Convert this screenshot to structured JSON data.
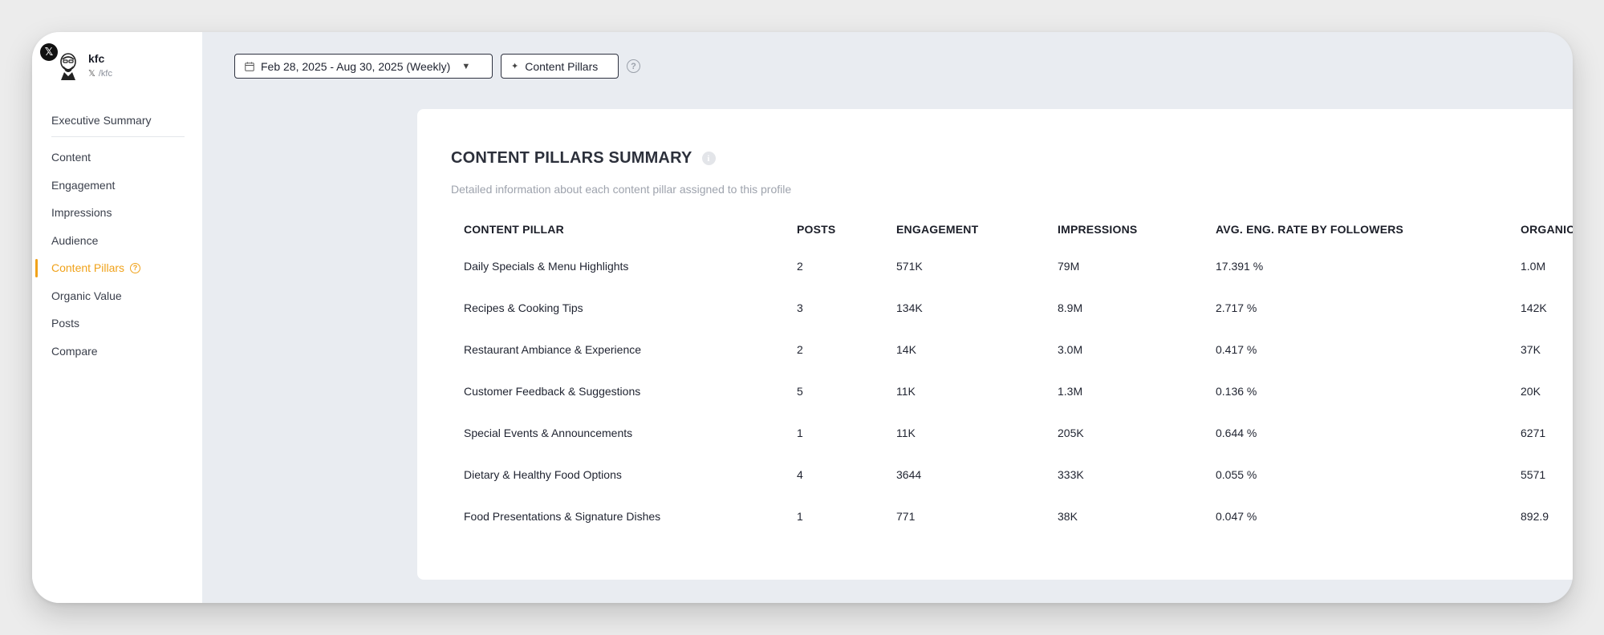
{
  "profile": {
    "name": "kfc",
    "handle": "/kfc",
    "platform_icon": "x-logo-icon"
  },
  "sidebar": {
    "items": [
      {
        "label": "Executive Summary"
      },
      {
        "label": "Content"
      },
      {
        "label": "Engagement"
      },
      {
        "label": "Impressions"
      },
      {
        "label": "Audience"
      },
      {
        "label": "Content Pillars",
        "active": true
      },
      {
        "label": "Organic Value"
      },
      {
        "label": "Posts"
      },
      {
        "label": "Compare"
      }
    ],
    "active_color": "#f0a21a"
  },
  "toolbar": {
    "date_range": "Feb 28, 2025 - Aug 30, 2025 (Weekly)",
    "content_pillars_button": "Content Pillars"
  },
  "card": {
    "title": "CONTENT PILLARS SUMMARY",
    "subtitle": "Detailed information about each content pillar assigned to this profile"
  },
  "table": {
    "headers": [
      "CONTENT PILLAR",
      "POSTS",
      "ENGAGEMENT",
      "IMPRESSIONS",
      "AVG. ENG. RATE BY FOLLOWERS",
      "ORGANIC VALUE"
    ],
    "rows": [
      [
        "Daily Specials & Menu Highlights",
        "2",
        "571K",
        "79M",
        "17.391 %",
        "1.0M"
      ],
      [
        "Recipes & Cooking Tips",
        "3",
        "134K",
        "8.9M",
        "2.717 %",
        "142K"
      ],
      [
        "Restaurant Ambiance & Experience",
        "2",
        "14K",
        "3.0M",
        "0.417 %",
        "37K"
      ],
      [
        "Customer Feedback & Suggestions",
        "5",
        "11K",
        "1.3M",
        "0.136 %",
        "20K"
      ],
      [
        "Special Events & Announcements",
        "1",
        "11K",
        "205K",
        "0.644 %",
        "6271"
      ],
      [
        "Dietary & Healthy Food Options",
        "4",
        "3644",
        "333K",
        "0.055 %",
        "5571"
      ],
      [
        "Food Presentations & Signature Dishes",
        "1",
        "771",
        "38K",
        "0.047 %",
        "892.9"
      ]
    ]
  }
}
